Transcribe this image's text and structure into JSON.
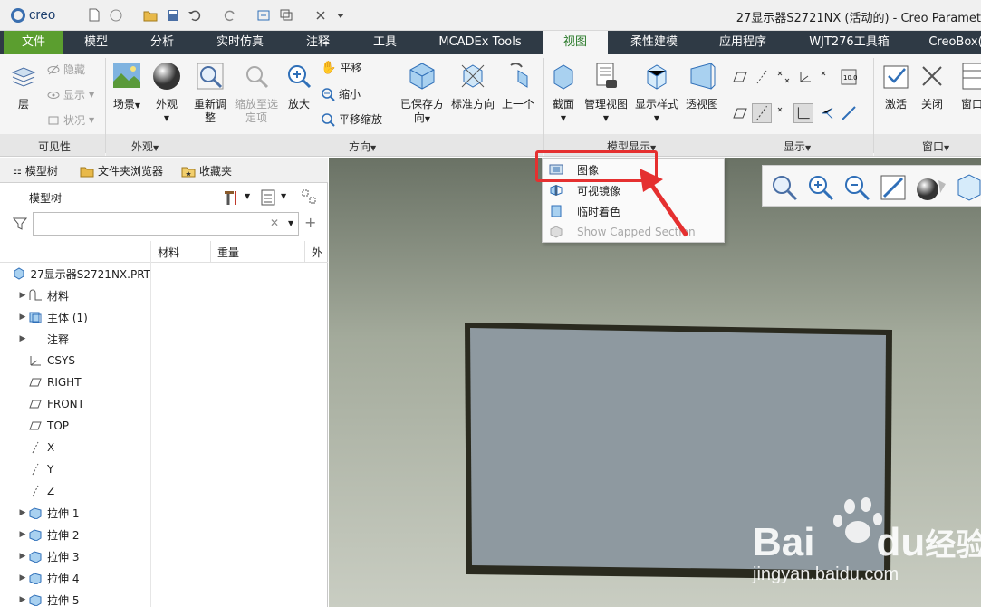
{
  "app": {
    "logo_text": "creo",
    "window_title": "27显示器S2721NX (活动的) - Creo Paramet"
  },
  "tabs": [
    "文件",
    "模型",
    "分析",
    "实时仿真",
    "注释",
    "工具",
    "MCADEx Tools",
    "视图",
    "柔性建模",
    "应用程序",
    "WJT276工具箱",
    "CreoBox("
  ],
  "active_tab": "视图",
  "ribbon": {
    "visibility": {
      "layer": "层",
      "hide": "隐藏",
      "show": "显示",
      "status": "状况",
      "label": "可见性"
    },
    "appearance": {
      "scene": "场景",
      "appearance": "外观",
      "label": "外观"
    },
    "orientation": {
      "refit_line1": "重新调",
      "refit_line2": "整",
      "zoom_sel_line1": "缩放至选",
      "zoom_sel_line2": "定项",
      "zoom_in": "放大",
      "pan": "平移",
      "zoom_out": "缩小",
      "pan_zoom": "平移缩放",
      "saved_line1": "已保存方",
      "saved_line2": "向",
      "std_orient": "标准方向",
      "previous": "上一个",
      "label": "方向"
    },
    "model_display": {
      "section": "截面",
      "manage_views": "管理视图",
      "display_style": "显示样式",
      "perspective": "透视图",
      "label": "模型显示"
    },
    "show": {
      "label": "显示"
    },
    "window": {
      "activate": "激活",
      "close": "关闭",
      "window": "窗口",
      "label": "窗口"
    }
  },
  "panel": {
    "tabs": [
      "模型树",
      "文件夹浏览器",
      "收藏夹"
    ],
    "title": "模型树",
    "filter_placeholder": "",
    "columns": [
      "材料",
      "重量",
      "外"
    ],
    "tree": [
      {
        "label": "27显示器S2721NX.PRT",
        "icon": "part-icon",
        "expand": false,
        "indent": 0
      },
      {
        "label": "材料",
        "icon": "material-icon",
        "expand": true,
        "indent": 1
      },
      {
        "label": "主体 (1)",
        "icon": "body-icon",
        "expand": true,
        "indent": 1
      },
      {
        "label": "注释",
        "icon": "",
        "expand": true,
        "indent": 1
      },
      {
        "label": "CSYS",
        "icon": "csys-icon",
        "expand": false,
        "indent": 1
      },
      {
        "label": "RIGHT",
        "icon": "datum-plane-icon",
        "expand": false,
        "indent": 1
      },
      {
        "label": "FRONT",
        "icon": "datum-plane-icon",
        "expand": false,
        "indent": 1
      },
      {
        "label": "TOP",
        "icon": "datum-plane-icon",
        "expand": false,
        "indent": 1
      },
      {
        "label": "X",
        "icon": "datum-axis-icon",
        "expand": false,
        "indent": 1
      },
      {
        "label": "Y",
        "icon": "datum-axis-icon",
        "expand": false,
        "indent": 1
      },
      {
        "label": "Z",
        "icon": "datum-axis-icon",
        "expand": false,
        "indent": 1
      },
      {
        "label": "拉伸 1",
        "icon": "extrude-icon",
        "expand": true,
        "indent": 1
      },
      {
        "label": "拉伸 2",
        "icon": "extrude-icon",
        "expand": true,
        "indent": 1
      },
      {
        "label": "拉伸 3",
        "icon": "extrude-icon",
        "expand": true,
        "indent": 1
      },
      {
        "label": "拉伸 4",
        "icon": "extrude-icon",
        "expand": true,
        "indent": 1
      },
      {
        "label": "拉伸 5",
        "icon": "extrude-icon",
        "expand": true,
        "indent": 1
      }
    ]
  },
  "dropdown": {
    "items": [
      {
        "label": "图像",
        "icon": "image-icon",
        "enabled": true
      },
      {
        "label": "可视镜像",
        "icon": "mirror-icon",
        "enabled": true
      },
      {
        "label": "临时着色",
        "icon": "shade-icon",
        "enabled": true
      },
      {
        "label": "Show Capped Section",
        "icon": "capped-section-icon",
        "enabled": false
      }
    ]
  },
  "watermark": {
    "brand": "Bai",
    "brand2": "du",
    "brand_suffix": "经验",
    "url": "jingyan.baidu.com"
  },
  "colors": {
    "file_tab": "#5b9e2f",
    "tab_bar": "#2f3a45",
    "highlight": "#e53030",
    "model_face": "#8e99a0"
  }
}
